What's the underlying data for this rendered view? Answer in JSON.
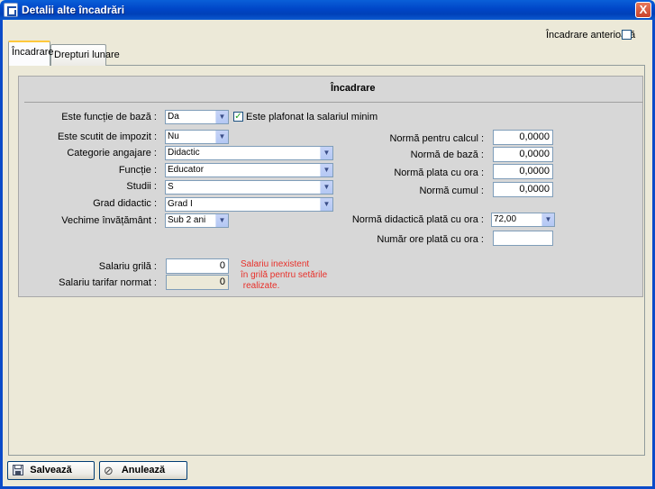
{
  "window": {
    "title": "Detalii alte încadrări",
    "close_label": "X"
  },
  "header": {
    "prior_label": "Încadrare anterioară",
    "prior_checked": false
  },
  "tabs": [
    {
      "label": "Încadrare",
      "active": true
    },
    {
      "label": "Drepturi lunare",
      "active": false
    }
  ],
  "section": {
    "title": "Încadrare"
  },
  "left": {
    "functie_baza": {
      "label": "Este funcție de bază :",
      "value": "Da"
    },
    "plafonat": {
      "label": "Este plafonat la salariul minim",
      "checked": true
    },
    "scutit_impozit": {
      "label": "Este scutit de impozit :",
      "value": "Nu"
    },
    "categorie": {
      "label": "Categorie angajare :",
      "value": "Didactic"
    },
    "functie": {
      "label": "Funcție :",
      "value": "Educator"
    },
    "studii": {
      "label": "Studii :",
      "value": "S"
    },
    "grad": {
      "label": "Grad didactic :",
      "value": "Grad I"
    },
    "vechime": {
      "label": "Vechime învățământ :",
      "value": "Sub 2 ani"
    },
    "salariu_grila": {
      "label": "Salariu grilă :",
      "value": "0"
    },
    "salariu_tarifar": {
      "label": "Salariu tarifar normat :",
      "value": "0"
    }
  },
  "warning": "Salariu inexistent\nîn grilă pentru setările\n realizate.",
  "right": {
    "norma_calcul": {
      "label": "Normă pentru calcul :",
      "value": "0,0000"
    },
    "norma_baza": {
      "label": "Normă de bază :",
      "value": "0,0000"
    },
    "norma_plata": {
      "label": "Normă plata cu ora :",
      "value": "0,0000"
    },
    "norma_cumul": {
      "label": "Normă cumul :",
      "value": "0,0000"
    },
    "norma_didactica": {
      "label": "Normă didactică plată cu ora :",
      "value": "72,00"
    },
    "numar_ore": {
      "label": "Număr ore plată cu ora :",
      "value": ""
    }
  },
  "buttons": {
    "save": "Salvează",
    "cancel": "Anulează"
  },
  "colors": {
    "accent": "#0b4bc9",
    "warning": "#e8302a",
    "check": "#21a121"
  },
  "icons": {
    "check_mark": "✓",
    "combo_arrow": "▼",
    "cancel_icon": "⊘"
  }
}
